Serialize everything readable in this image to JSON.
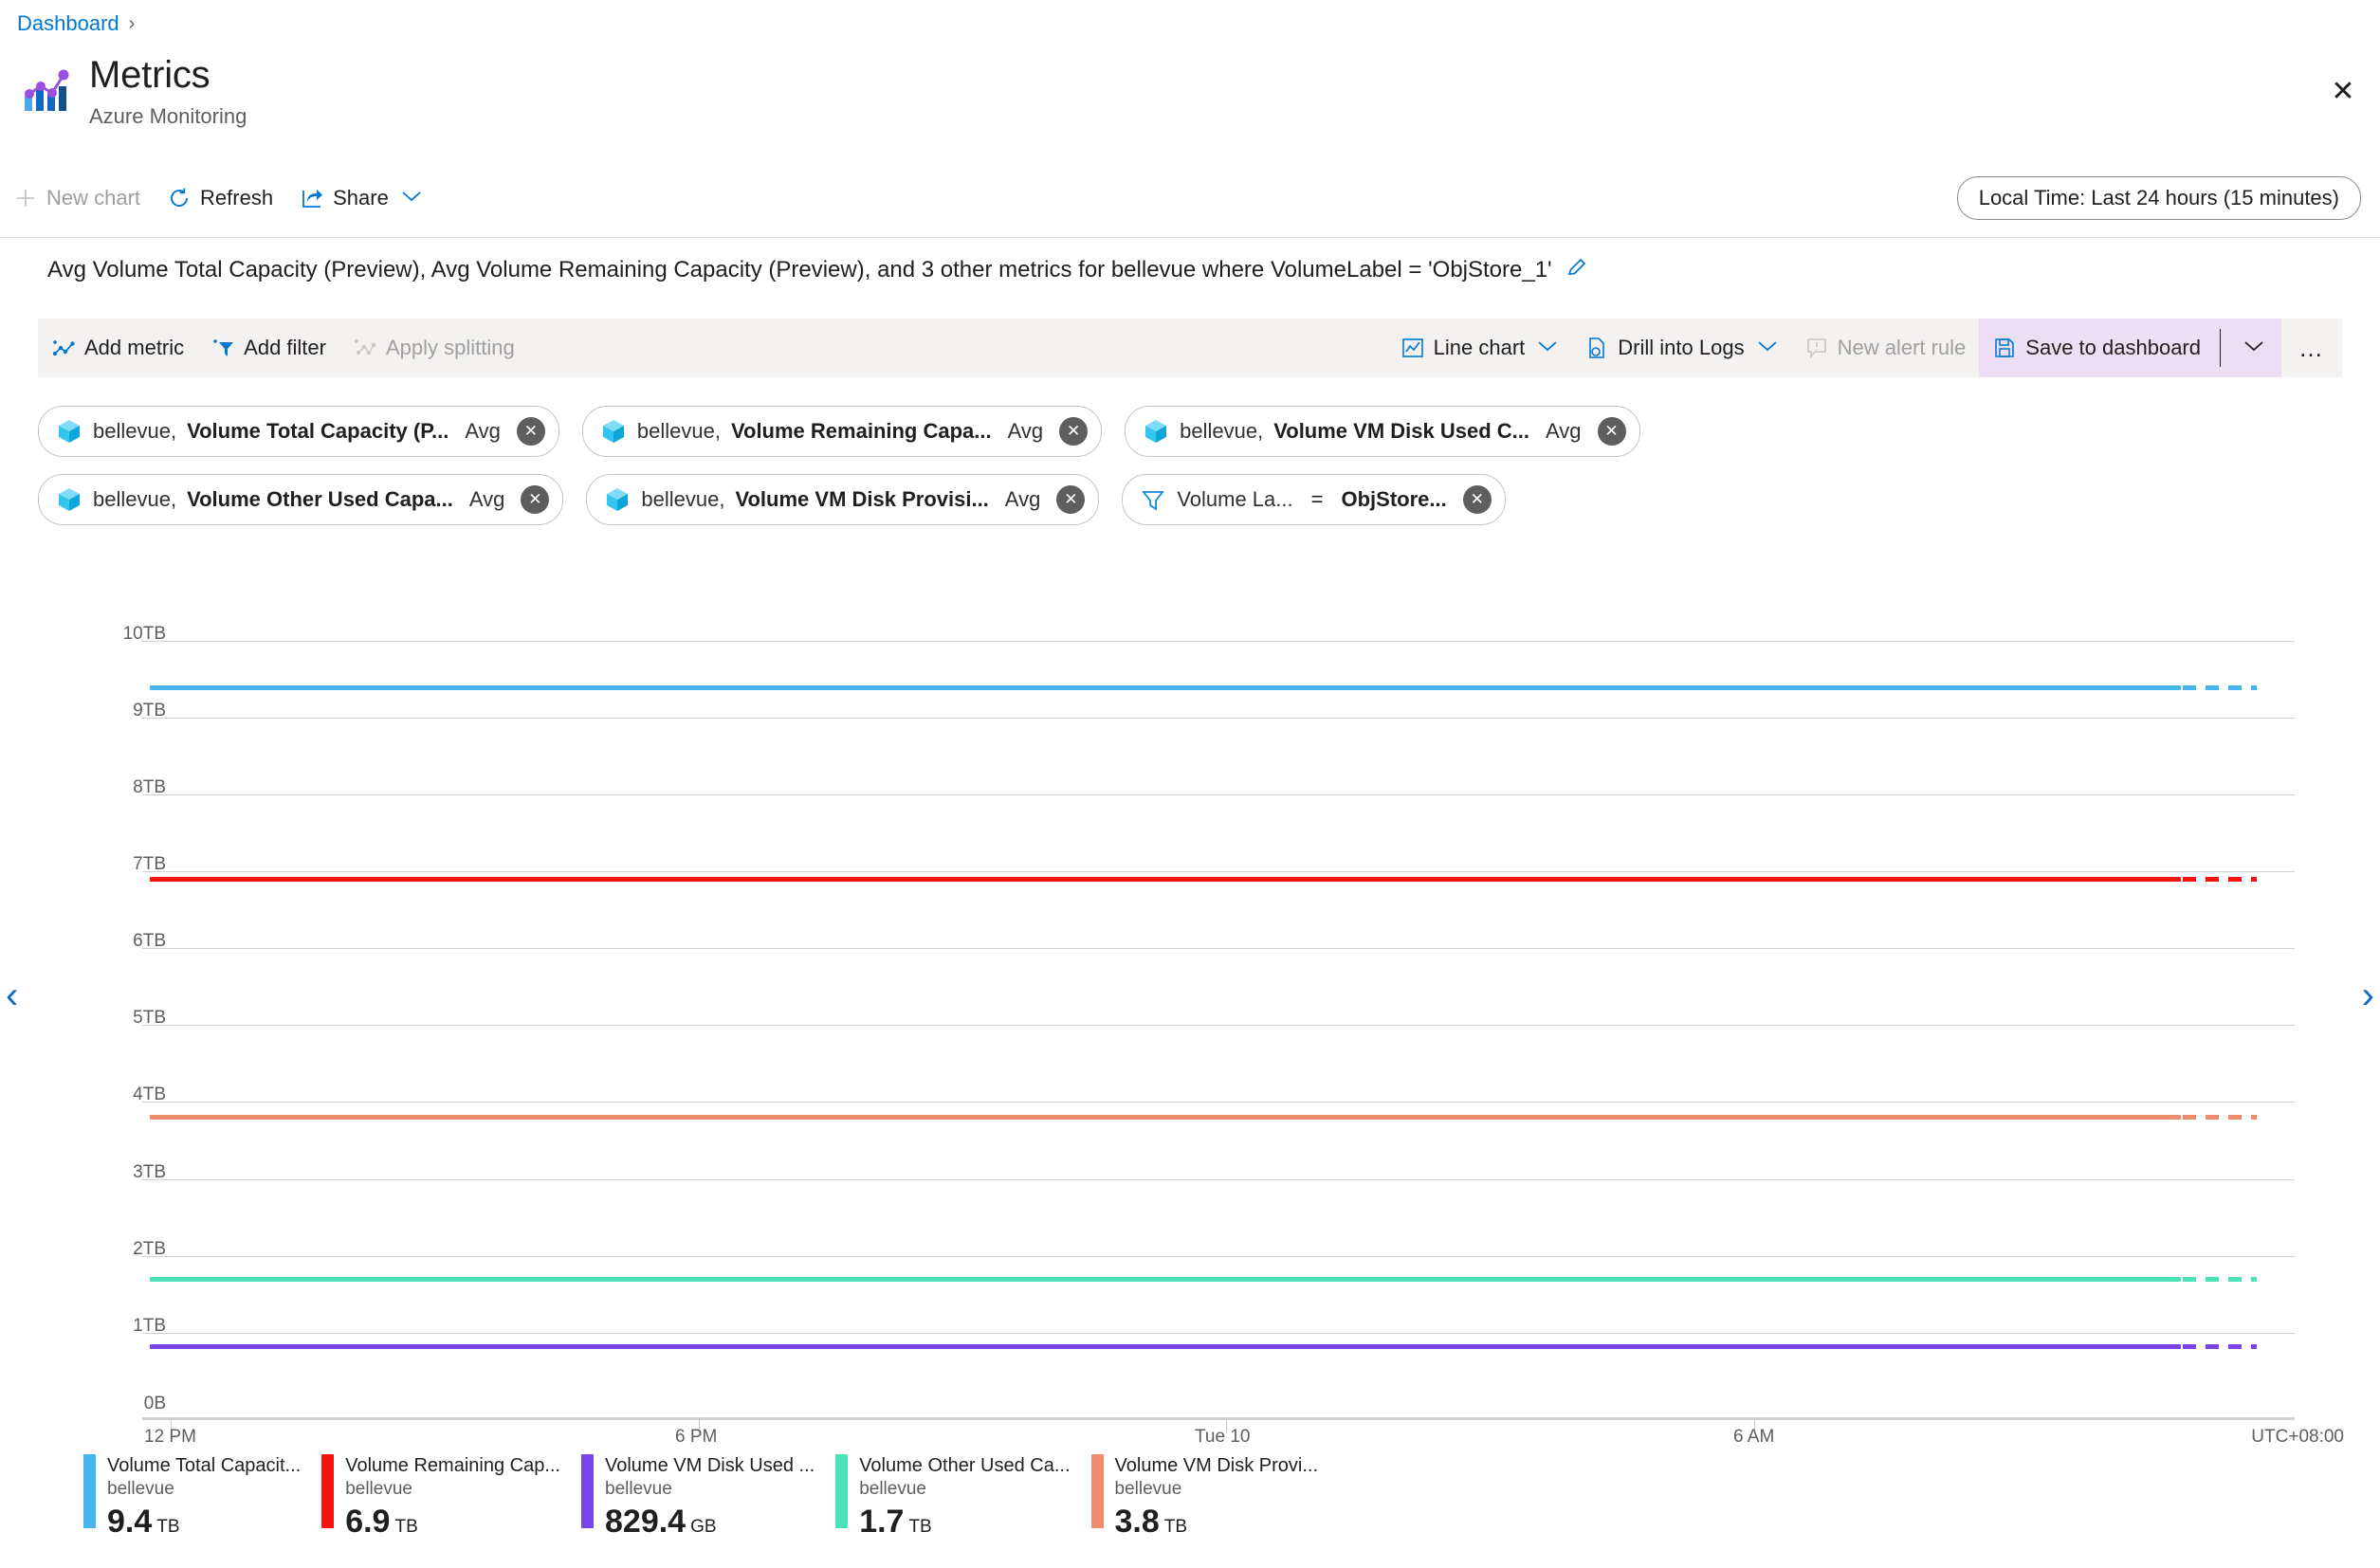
{
  "breadcrumb": {
    "root": "Dashboard",
    "separator": "›"
  },
  "header": {
    "title": "Metrics",
    "subtitle": "Azure Monitoring",
    "close_label": "✕"
  },
  "commandbar": {
    "new_chart": "New chart",
    "refresh": "Refresh",
    "share": "Share",
    "time_range": "Local Time: Last 24 hours (15 minutes)"
  },
  "chart_header": {
    "title": "Avg Volume Total Capacity (Preview), Avg Volume Remaining Capacity (Preview), and 3 other metrics for bellevue where VolumeLabel = 'ObjStore_1'",
    "edit_label": "✎"
  },
  "chart_toolbar": {
    "add_metric": "Add metric",
    "add_filter": "Add filter",
    "apply_splitting": "Apply splitting",
    "line_chart": "Line chart",
    "drill_into_logs": "Drill into Logs",
    "new_alert_rule": "New alert rule",
    "save_to_dashboard": "Save to dashboard",
    "more": "…"
  },
  "chips": [
    {
      "resource": "bellevue,",
      "metric": "Volume Total Capacity (P...",
      "agg": "Avg",
      "type": "metric"
    },
    {
      "resource": "bellevue,",
      "metric": "Volume Remaining Capa...",
      "agg": "Avg",
      "type": "metric"
    },
    {
      "resource": "bellevue,",
      "metric": "Volume VM Disk Used C...",
      "agg": "Avg",
      "type": "metric"
    },
    {
      "resource": "bellevue,",
      "metric": "Volume Other Used Capa...",
      "agg": "Avg",
      "type": "metric"
    },
    {
      "resource": "bellevue,",
      "metric": "Volume VM Disk Provisi...",
      "agg": "Avg",
      "type": "metric"
    },
    {
      "dimension": "Volume La...",
      "operator": "=",
      "value": "ObjStore...",
      "type": "filter"
    }
  ],
  "chart_data": {
    "type": "line",
    "title": "Avg Volume Total Capacity (Preview), Avg Volume Remaining Capacity (Preview), and 3 other metrics for bellevue where VolumeLabel = 'ObjStore_1'",
    "xlabel": "",
    "ylabel": "",
    "grid": true,
    "legend_position": "bottom",
    "timezone": "UTC+08:00",
    "x_ticks": [
      "12 PM",
      "6 PM",
      "Tue 10",
      "6 AM"
    ],
    "y_ticks": [
      "0B",
      "1TB",
      "2TB",
      "3TB",
      "4TB",
      "5TB",
      "6TB",
      "7TB",
      "8TB",
      "9TB",
      "10TB"
    ],
    "ylim": [
      0,
      10
    ],
    "yunit": "TB",
    "series": [
      {
        "name": "Volume Total Capacit...",
        "resource": "bellevue",
        "value": 9.4,
        "unit": "TB",
        "value_tb": 9.4,
        "color": "#45b5f0"
      },
      {
        "name": "Volume Remaining Cap...",
        "resource": "bellevue",
        "value": 6.9,
        "unit": "TB",
        "value_tb": 6.9,
        "color": "#fa1010"
      },
      {
        "name": "Volume VM Disk Used ...",
        "resource": "bellevue",
        "value": 829.4,
        "unit": "GB",
        "value_tb": 0.829,
        "color": "#7a45e8"
      },
      {
        "name": "Volume Other Used Ca...",
        "resource": "bellevue",
        "value": 1.7,
        "unit": "TB",
        "value_tb": 1.7,
        "color": "#4ae3b8"
      },
      {
        "name": "Volume VM Disk Provi...",
        "resource": "bellevue",
        "value": 3.8,
        "unit": "TB",
        "value_tb": 3.8,
        "color": "#ef8b6b"
      }
    ]
  },
  "nav": {
    "prev": "‹",
    "next": "›"
  }
}
